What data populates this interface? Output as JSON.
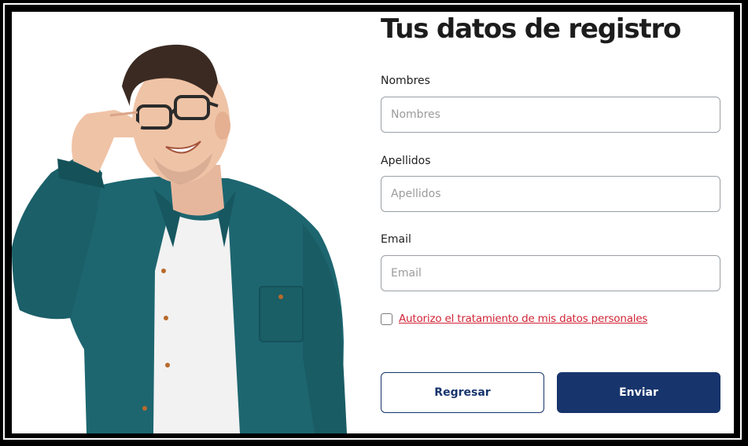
{
  "form": {
    "title": "Tus datos de registro",
    "fields": [
      {
        "label": "Nombres",
        "placeholder": "Nombres",
        "value": ""
      },
      {
        "label": "Apellidos",
        "placeholder": "Apellidos",
        "value": ""
      },
      {
        "label": "Email",
        "placeholder": "Email",
        "value": ""
      }
    ],
    "consent": {
      "checked": false,
      "label": "Autorizo el tratamiento de mis datos personales"
    },
    "buttons": {
      "back_label": "Regresar",
      "submit_label": "Enviar"
    }
  },
  "colors": {
    "primary": "#17356c",
    "consent_link": "#d02536",
    "input_border": "#9aa0a6",
    "background": "#ffffff",
    "shirt": "#1d6670"
  }
}
